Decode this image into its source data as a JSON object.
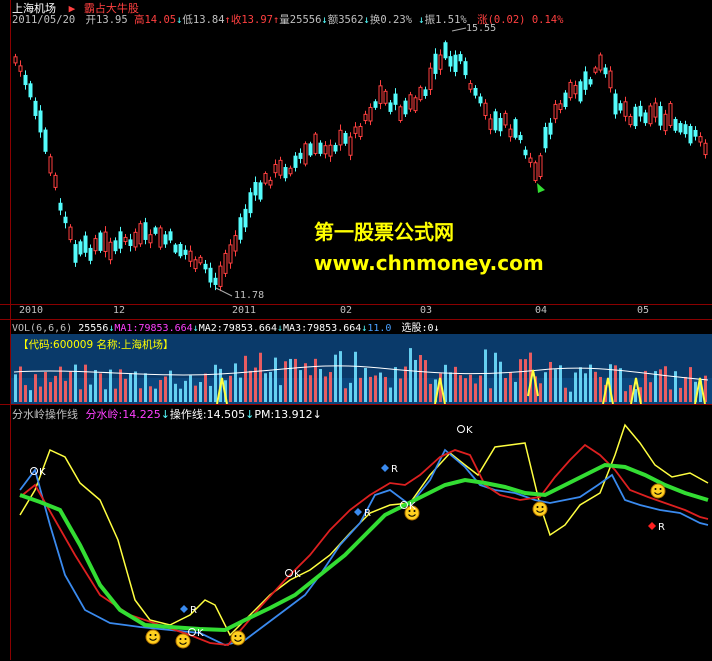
{
  "header": {
    "stock_name": "上海机场",
    "flag": "▶",
    "tag": "霸占大牛股",
    "date": "2011/05/20",
    "open_label": "开",
    "open_value": "13.95",
    "high_label": "高",
    "high_value": "14.05",
    "low_label": "低",
    "low_value": "13.84",
    "close_label": "收",
    "close_value": "13.97",
    "volume_label": "量",
    "volume_value": "25556",
    "amount_label": "额",
    "amount_value": "3562",
    "turnover_label": "换",
    "turnover_value": "0.23%",
    "amplitude_label": "振",
    "amplitude_value": "1.51%",
    "change_label": "涨",
    "change_value": "(0.02)",
    "change_pct": "0.14%"
  },
  "main": {
    "high_marker": "15.55",
    "low_marker": "11.78",
    "watermark_title": "第一股票公式网",
    "watermark_url": "www.chnmoney.com"
  },
  "time_axis": [
    "2010",
    "12",
    "2011",
    "02",
    "03",
    "04",
    "05"
  ],
  "volume_bar": {
    "label": "VOL(6,6,6)",
    "vol": "25556",
    "ma1": "MA1:79853.664",
    "ma2": "MA2:79853.664",
    "ma3": "MA3:79853.664",
    "extra": "11.0",
    "select": "选股:0",
    "code_info": "【代码:600009 名称:上海机场】"
  },
  "indicator": {
    "title": "分水岭操作线",
    "fsl": "分水岭:14.225",
    "czx": "操作线:14.505",
    "pm": "PM:13.912",
    "labels": {
      "k": "K",
      "r": "R"
    }
  },
  "colors": {
    "up": "#ff4040",
    "down": "#54fcfc",
    "frame": "#8a0000",
    "volume_area": "#0a3a6a",
    "green_line": "#33dd33",
    "yellow_line": "#ffff40",
    "blue_line": "#3a8aee",
    "red_line": "#dd2020"
  }
}
